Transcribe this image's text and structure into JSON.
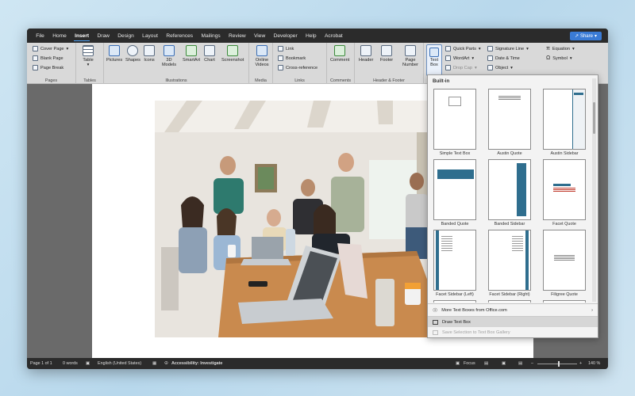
{
  "menu": {
    "tabs": [
      "File",
      "Home",
      "Insert",
      "Draw",
      "Design",
      "Layout",
      "References",
      "Mailings",
      "Review",
      "View",
      "Developer",
      "Help",
      "Acrobat"
    ],
    "active": "Insert",
    "share": "Share"
  },
  "ribbon": {
    "pages": {
      "label": "Pages",
      "cover_page": "Cover Page",
      "blank_page": "Blank Page",
      "page_break": "Page Break"
    },
    "tables": {
      "label": "Tables",
      "table": "Table"
    },
    "illustrations": {
      "label": "Illustrations",
      "pictures": "Pictures",
      "shapes": "Shapes",
      "icons": "Icons",
      "models_3d": "3D Models",
      "smartart": "SmartArt",
      "chart": "Chart",
      "screenshot": "Screenshot"
    },
    "media": {
      "label": "Media",
      "online_videos": "Online Videos"
    },
    "links": {
      "label": "Links",
      "link": "Link",
      "bookmark": "Bookmark",
      "cross_reference": "Cross-reference"
    },
    "comments": {
      "label": "Comments",
      "comment": "Comment"
    },
    "header_footer": {
      "label": "Header & Footer",
      "header": "Header",
      "footer": "Footer",
      "page_number": "Page Number"
    },
    "text": {
      "text_box": "Text Box",
      "quick_parts": "Quick Parts",
      "wordart": "WordArt",
      "drop_cap": "Drop Cap",
      "signature_line": "Signature Line",
      "date_time": "Date & Time",
      "object": "Object"
    },
    "symbols": {
      "equation": "Equation",
      "symbol": "Symbol"
    }
  },
  "gallery": {
    "heading": "Built-in",
    "items": [
      "Simple Text Box",
      "Austin Quote",
      "Austin Sidebar",
      "Banded Quote",
      "Banded Sidebar",
      "Facet Quote",
      "Facet Sidebar (Left)",
      "Facet Sidebar (Right)",
      "Filigree Quote"
    ],
    "more": "More Text Boxes from Office.com",
    "draw": "Draw Text Box",
    "save": "Save Selection to Text Box Gallery",
    "accent": "#2f6e8e"
  },
  "status": {
    "page": "Page 1 of 1",
    "words": "0 words",
    "language": "English (United States)",
    "accessibility": "Accessibility: Investigate",
    "focus": "Focus",
    "zoom": "140 %"
  }
}
